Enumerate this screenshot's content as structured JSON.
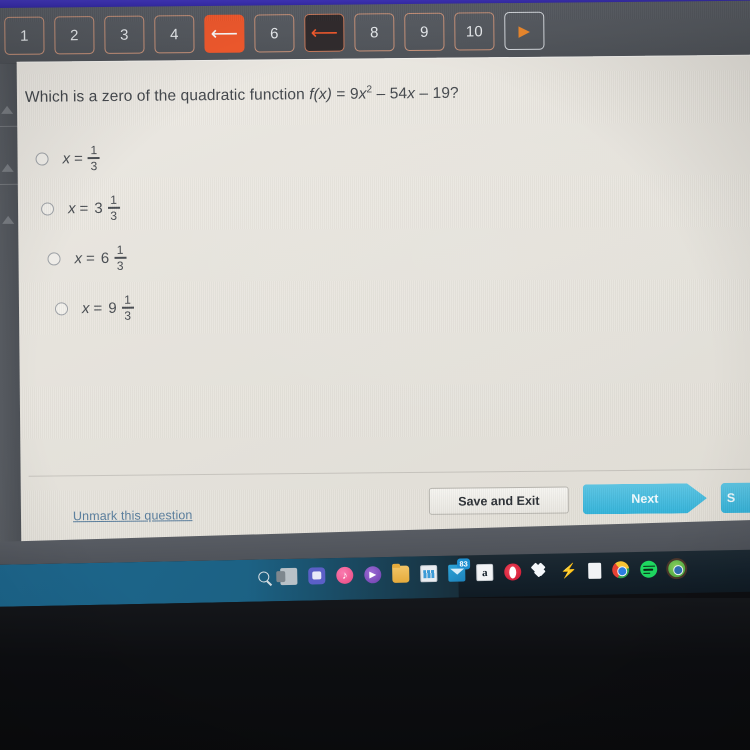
{
  "nav": {
    "items": [
      {
        "label": "1",
        "type": "number"
      },
      {
        "label": "2",
        "type": "number"
      },
      {
        "label": "3",
        "type": "number"
      },
      {
        "label": "4",
        "type": "number"
      },
      {
        "label": "",
        "type": "flag-active",
        "icon": "flag-icon"
      },
      {
        "label": "6",
        "type": "number"
      },
      {
        "label": "",
        "type": "flag-dark",
        "icon": "flag-icon"
      },
      {
        "label": "8",
        "type": "number"
      },
      {
        "label": "9",
        "type": "number"
      },
      {
        "label": "10",
        "type": "number"
      },
      {
        "label": "",
        "type": "next-arrow",
        "icon": "triangle-right-icon"
      }
    ]
  },
  "question": {
    "prompt_prefix": "Which is a zero of the quadratic function ",
    "function_name": "f",
    "function_arg": "(x)",
    "equals": " = 9",
    "variable": "x",
    "exponent": "2",
    "remainder": " – 54",
    "variable2": "x",
    "tail": " – 19?",
    "full_text": "Which is a zero of the quadratic function f(x) = 9x2 – 54x – 19?"
  },
  "options": [
    {
      "id": "option-a",
      "prefix": "x",
      "eq": "=",
      "whole": "",
      "numerator": "1",
      "denominator": "3",
      "selected": false
    },
    {
      "id": "option-b",
      "prefix": "x",
      "eq": "=",
      "whole": "3",
      "numerator": "1",
      "denominator": "3",
      "selected": false
    },
    {
      "id": "option-c",
      "prefix": "x",
      "eq": "=",
      "whole": "6",
      "numerator": "1",
      "denominator": "3",
      "selected": false
    },
    {
      "id": "option-d",
      "prefix": "x",
      "eq": "=",
      "whole": "9",
      "numerator": "1",
      "denominator": "3",
      "selected": false
    }
  ],
  "footer": {
    "unmark_link": "Unmark this question",
    "save_exit_label": "Save and Exit",
    "next_label": "Next",
    "extra_label": "S"
  },
  "taskbar": {
    "icons": [
      {
        "name": "windows-start-icon",
        "label": ""
      },
      {
        "name": "search-icon",
        "label": ""
      },
      {
        "name": "task-view-icon",
        "label": ""
      },
      {
        "name": "teams-icon",
        "label": ""
      },
      {
        "name": "music-icon",
        "label": "♪"
      },
      {
        "name": "media-player-icon",
        "label": "▶"
      },
      {
        "name": "file-explorer-icon",
        "label": ""
      },
      {
        "name": "microsoft-store-icon",
        "label": ""
      },
      {
        "name": "mail-icon",
        "label": "",
        "badge": "83"
      },
      {
        "name": "amazon-icon",
        "label": "a"
      },
      {
        "name": "opera-icon",
        "label": ""
      },
      {
        "name": "dropbox-icon",
        "label": ""
      },
      {
        "name": "bolt-icon",
        "label": "⚡"
      },
      {
        "name": "document-icon",
        "label": ""
      },
      {
        "name": "chrome-icon",
        "label": ""
      },
      {
        "name": "spotify-icon",
        "label": ""
      },
      {
        "name": "active-app-icon",
        "label": ""
      }
    ]
  },
  "colors": {
    "top_strip": "#3b30b2",
    "nav_bar": "#55595f",
    "flag_active": "#f4592c",
    "page_bg": "#e9e7e1",
    "next_button": "#35b4da",
    "link": "#5b7f9e",
    "taskbar": "#14212b"
  }
}
